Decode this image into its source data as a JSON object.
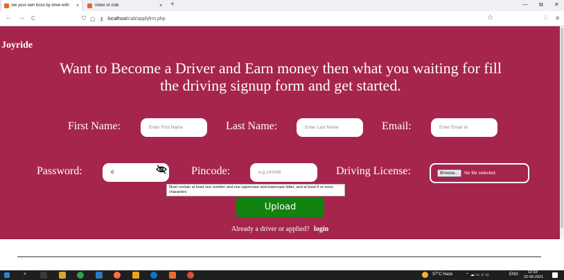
{
  "browser": {
    "tabs": [
      {
        "title": "Be your own boss by drive with",
        "close": "×"
      },
      {
        "title": "Index of /cab",
        "close": "×"
      }
    ],
    "new_tab": "+",
    "window_controls": {
      "minimize": "—",
      "restore": "⧉",
      "close": "✕"
    },
    "nav": {
      "back": "←",
      "forward": "→",
      "reload": "C"
    },
    "url_host": "localhost",
    "url_path": "/cab/applyfrm.php",
    "bookmark_icon": "☆"
  },
  "page": {
    "brand": "Joyride",
    "headline": "Want to Become a Driver and Earn money then what you waiting for fill the driving signup form and get started.",
    "first_name": {
      "label": "First Name:",
      "placeholder": "Enter First Name"
    },
    "last_name": {
      "label": "Last Name:",
      "placeholder": "Enter Last Name"
    },
    "email": {
      "label": "Email:",
      "placeholder": "Enter Email Id"
    },
    "password": {
      "label": "Password:",
      "value": "d"
    },
    "pincode": {
      "label": "Pincode:",
      "placeholder": "e.g.141008"
    },
    "license": {
      "label": "Driving License:",
      "browse": "Browse...",
      "status": "No file selected."
    },
    "password_hint": "Must contain at least one number and one uppercase and lowercase letter, and at least 8 or more characters",
    "upload_button": "Upload",
    "already_text": "Already a driver or applied?",
    "login_link": "login"
  },
  "taskbar": {
    "weather": "37°C  Haze",
    "language": "ENG",
    "time": "12:33",
    "date": "22-06-2021"
  },
  "colors": {
    "page_bg": "#a6254d",
    "upload_bg": "#128210"
  }
}
